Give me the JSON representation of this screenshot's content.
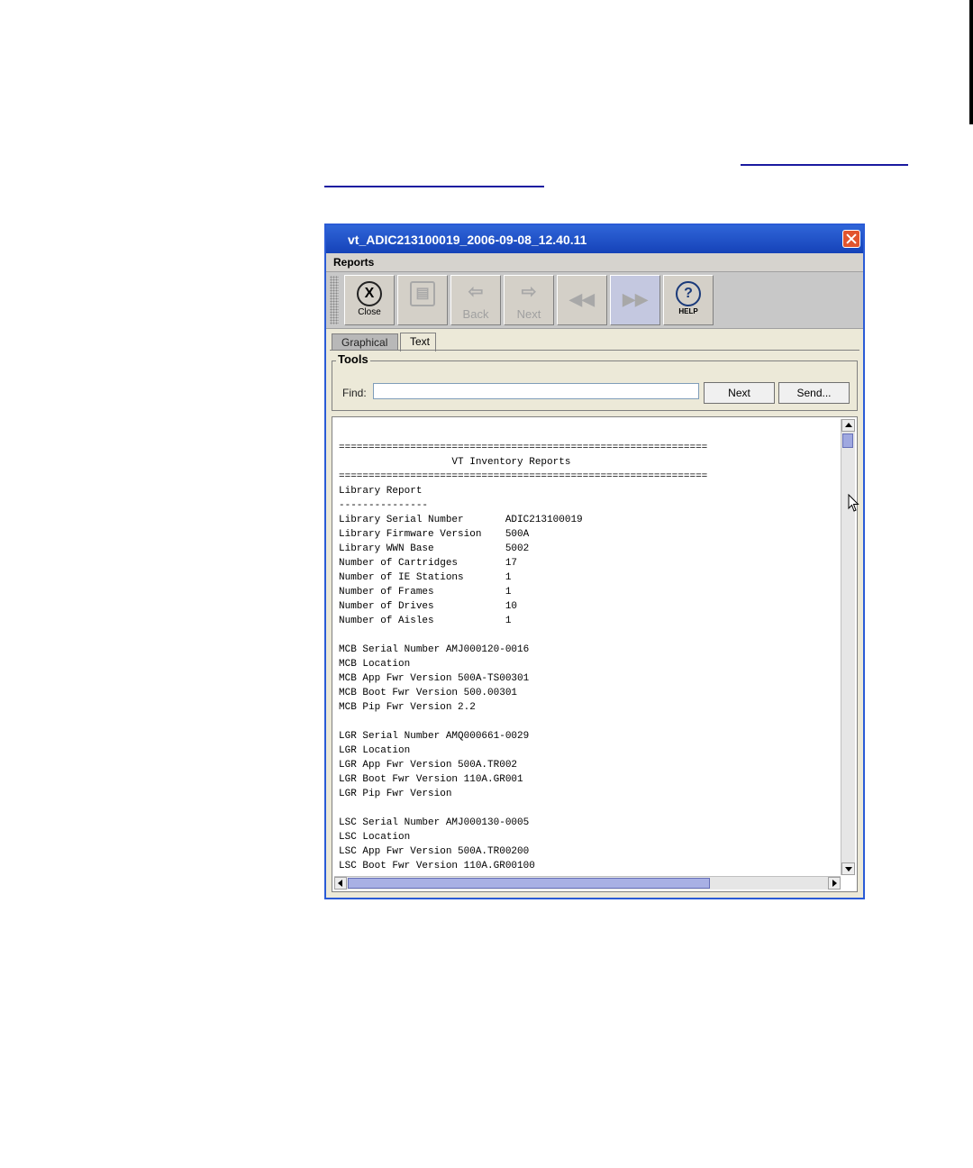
{
  "window": {
    "title": "vt_ADIC213100019_2006-09-08_12.40.11"
  },
  "menu": {
    "items": [
      "Reports"
    ]
  },
  "toolbar": {
    "buttons": [
      {
        "label": "Close",
        "icon": "close-icon",
        "enabled": true
      },
      {
        "label": "",
        "icon": "save-document-icon",
        "enabled": false
      },
      {
        "label": "Back",
        "icon": "back-arrow-icon",
        "enabled": false
      },
      {
        "label": "Next",
        "icon": "next-arrow-icon",
        "enabled": false
      },
      {
        "label": "",
        "icon": "rewind-icon",
        "enabled": false
      },
      {
        "label": "",
        "icon": "fast-forward-icon",
        "enabled": false
      },
      {
        "label": "HELP",
        "icon": "help-icon",
        "enabled": true
      }
    ]
  },
  "tabs": [
    "Graphical",
    "Text"
  ],
  "active_tab": "Text",
  "tools": {
    "legend": "Tools",
    "find_label": "Find:",
    "find_value": "",
    "next_label": "Next",
    "send_label": "Send..."
  },
  "report": {
    "lines": [
      "==============================================================",
      "                   VT Inventory Reports",
      "==============================================================",
      "Library Report",
      "---------------",
      "Library Serial Number       ADIC213100019",
      "Library Firmware Version    500A",
      "Library WWN Base            5002",
      "Number of Cartridges        17",
      "Number of IE Stations       1",
      "Number of Frames            1",
      "Number of Drives            10",
      "Number of Aisles            1",
      "",
      "MCB Serial Number AMJ000120-0016",
      "MCB Location",
      "MCB App Fwr Version 500A-TS00301",
      "MCB Boot Fwr Version 500.00301",
      "MCB Pip Fwr Version 2.2",
      "",
      "LGR Serial Number AMQ000661-0029",
      "LGR Location",
      "LGR App Fwr Version 500A.TR002",
      "LGR Boot Fwr Version 110A.GR001",
      "LGR Pip Fwr Version",
      "",
      "LSC Serial Number AMJ000130-0005",
      "LSC Location",
      "LSC App Fwr Version 500A.TR00200",
      "LSC Boot Fwr Version 110A.GR00100"
    ]
  }
}
